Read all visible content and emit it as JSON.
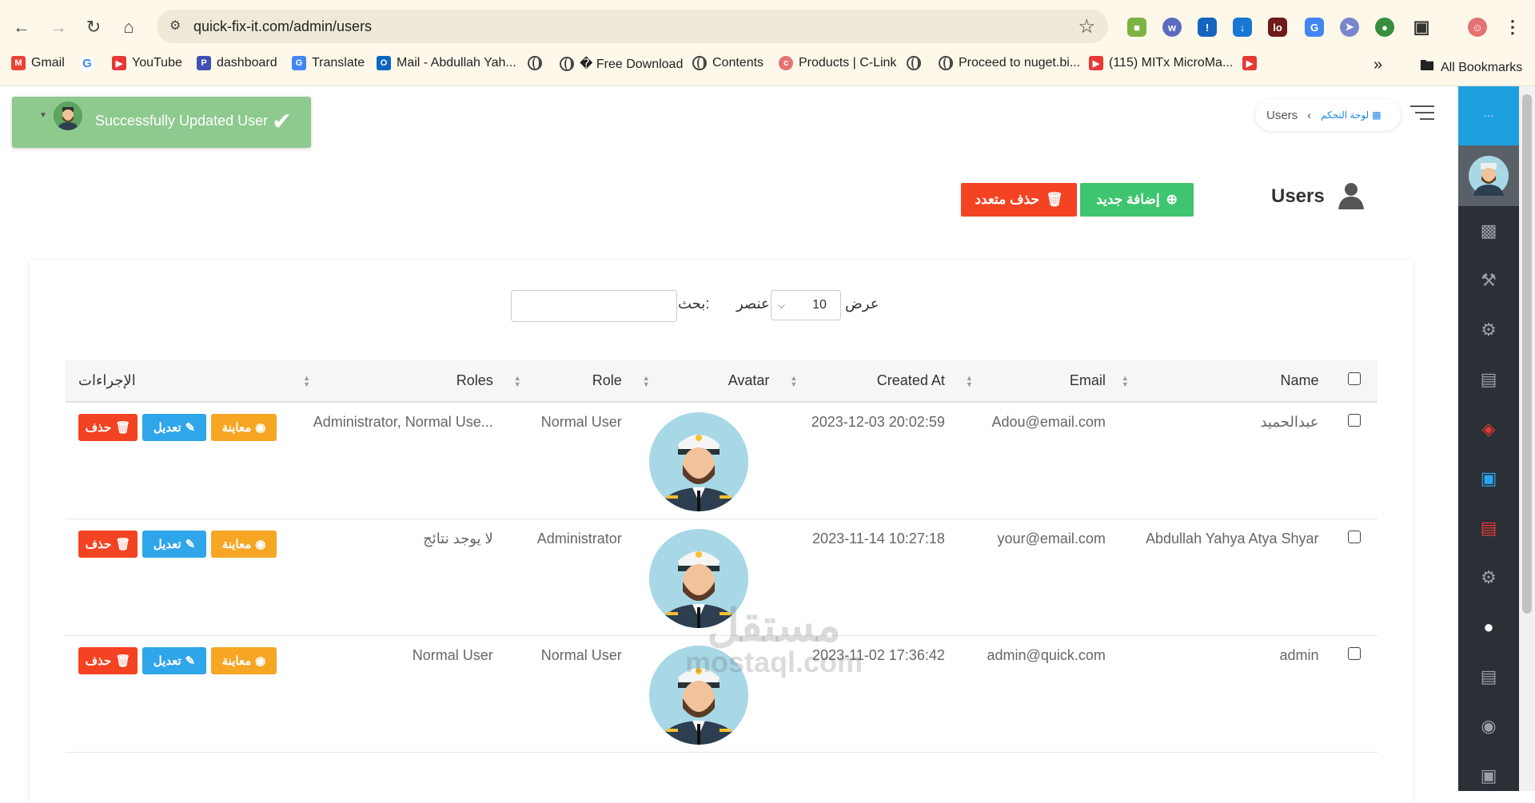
{
  "browser": {
    "url": "quick-fix-it.com/admin/users",
    "bookmarks": [
      {
        "label": "Gmail",
        "icon": "gmail-icon"
      },
      {
        "label": "",
        "icon": "google-icon"
      },
      {
        "label": "YouTube",
        "icon": "youtube-icon"
      },
      {
        "label": "dashboard",
        "icon": "dashboard-icon"
      },
      {
        "label": "Translate",
        "icon": "translate-icon"
      },
      {
        "label": "Mail - Abdullah Yah...",
        "icon": "outlook-icon"
      },
      {
        "label": "",
        "icon": "globe-icon"
      },
      {
        "label": "� Free Download",
        "icon": "globe-icon"
      },
      {
        "label": "Contents",
        "icon": "globe-icon"
      },
      {
        "label": "Products | C-Link",
        "icon": "clink-icon"
      },
      {
        "label": "",
        "icon": "globe-icon"
      },
      {
        "label": "Proceed to nuget.bi...",
        "icon": "globe-icon"
      },
      {
        "label": "(115) MITx MicroMa...",
        "icon": "youtube-icon"
      },
      {
        "label": "",
        "icon": "youtube-icon"
      }
    ],
    "all_bookmarks": "All Bookmarks"
  },
  "toast": {
    "message": "Successfully Updated User"
  },
  "breadcrumb": {
    "current": "Users",
    "home": "لوحة التحكم"
  },
  "header": {
    "title": "Users",
    "add_label": "إضافة جديد",
    "multi_delete_label": "حذف متعدد"
  },
  "controls": {
    "show": "عرض",
    "page_size": "10",
    "entries": "عنصر",
    "search": "بحث:"
  },
  "table": {
    "columns": {
      "name": "Name",
      "email": "Email",
      "created_at": "Created At",
      "avatar": "Avatar",
      "role": "Role",
      "roles": "Roles",
      "actions": "الإجراءات"
    },
    "rows": [
      {
        "name": "عبدالحميد",
        "email": "Adou@email.com",
        "created_at": "2023-12-03 20:02:59",
        "role": "Normal User",
        "roles": "Administrator, Normal Use..."
      },
      {
        "name": "Abdullah Yahya Atya Shyar",
        "email": "your@email.com",
        "created_at": "2023-11-14 10:27:18",
        "role": "Administrator",
        "roles": "لا يوجد نتائج"
      },
      {
        "name": "admin",
        "email": "admin@quick.com",
        "created_at": "2023-11-02 17:36:42",
        "role": "Normal User",
        "roles": "Normal User"
      }
    ],
    "actions": {
      "view": "معاينة",
      "edit": "تعديل",
      "delete": "حذف"
    }
  },
  "watermark": {
    "ar": "مستقل",
    "en": "mostaql.com"
  },
  "colors": {
    "success": "#3fc46f",
    "danger": "#f44322",
    "warning": "#f6a623",
    "info": "#2fa5ea",
    "sidebar": "#2b2f36",
    "sidebar_top": "#1e9fe0"
  }
}
